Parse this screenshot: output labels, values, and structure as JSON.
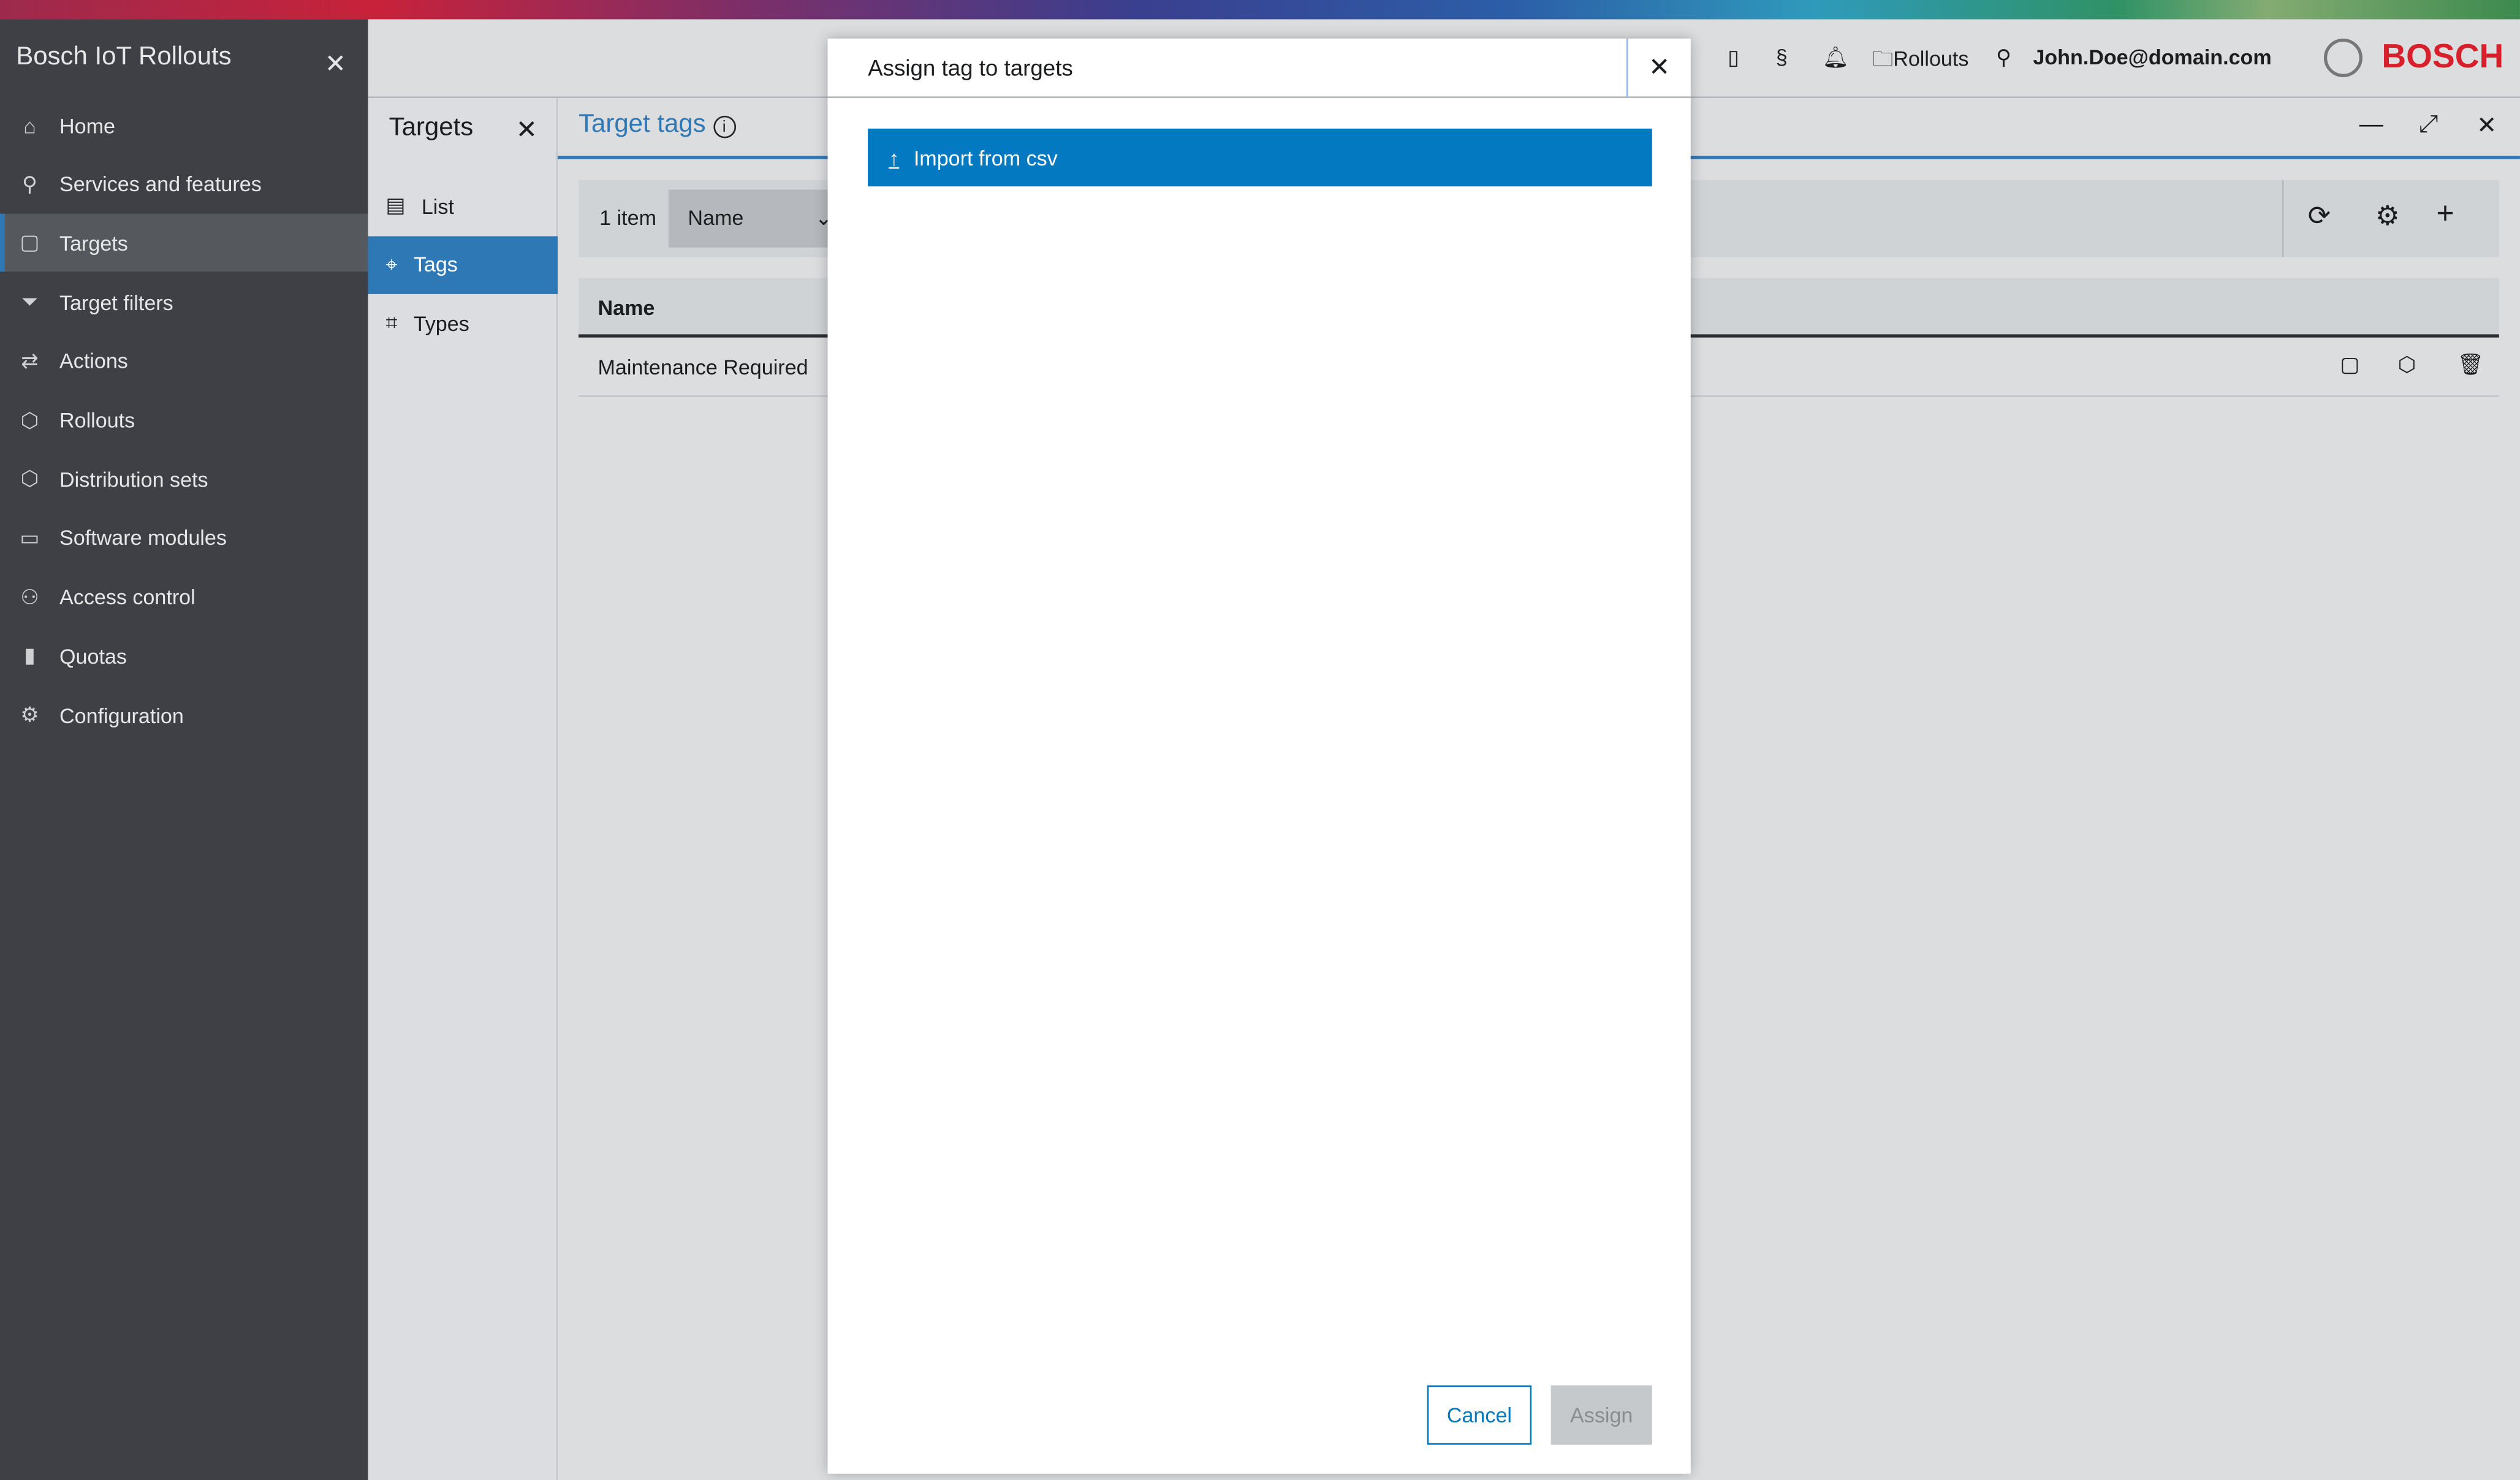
{
  "app": {
    "title": "Bosch IoT Rollouts",
    "brand": "BOSCH"
  },
  "sidebar": {
    "items": [
      {
        "label": "Home",
        "icon": "⌂"
      },
      {
        "label": "Services and features",
        "icon": "⚲"
      },
      {
        "label": "Targets",
        "icon": "▢"
      },
      {
        "label": "Target filters",
        "icon": "⏷"
      },
      {
        "label": "Actions",
        "icon": "⇄"
      },
      {
        "label": "Rollouts",
        "icon": "⬡"
      },
      {
        "label": "Distribution sets",
        "icon": "⬡"
      },
      {
        "label": "Software modules",
        "icon": "▭"
      },
      {
        "label": "Access control",
        "icon": "⚇"
      },
      {
        "label": "Quotas",
        "icon": "▮"
      },
      {
        "label": "Configuration",
        "icon": "⚙"
      }
    ]
  },
  "secondary": {
    "title": "Targets",
    "items": [
      {
        "label": "List",
        "icon": "▤"
      },
      {
        "label": "Tags",
        "icon": "⌖"
      },
      {
        "label": "Types",
        "icon": "⌗"
      }
    ]
  },
  "header": {
    "project": "Rollouts",
    "user": "John.Doe@domain.com"
  },
  "main": {
    "title": "Target tags",
    "count": "1 item",
    "sort": "Name",
    "column": "Name",
    "rows": [
      {
        "name": "Maintenance Required"
      }
    ]
  },
  "dialog": {
    "title": "Assign tag to targets",
    "import_label": "Import from csv",
    "cancel": "Cancel",
    "assign": "Assign"
  }
}
